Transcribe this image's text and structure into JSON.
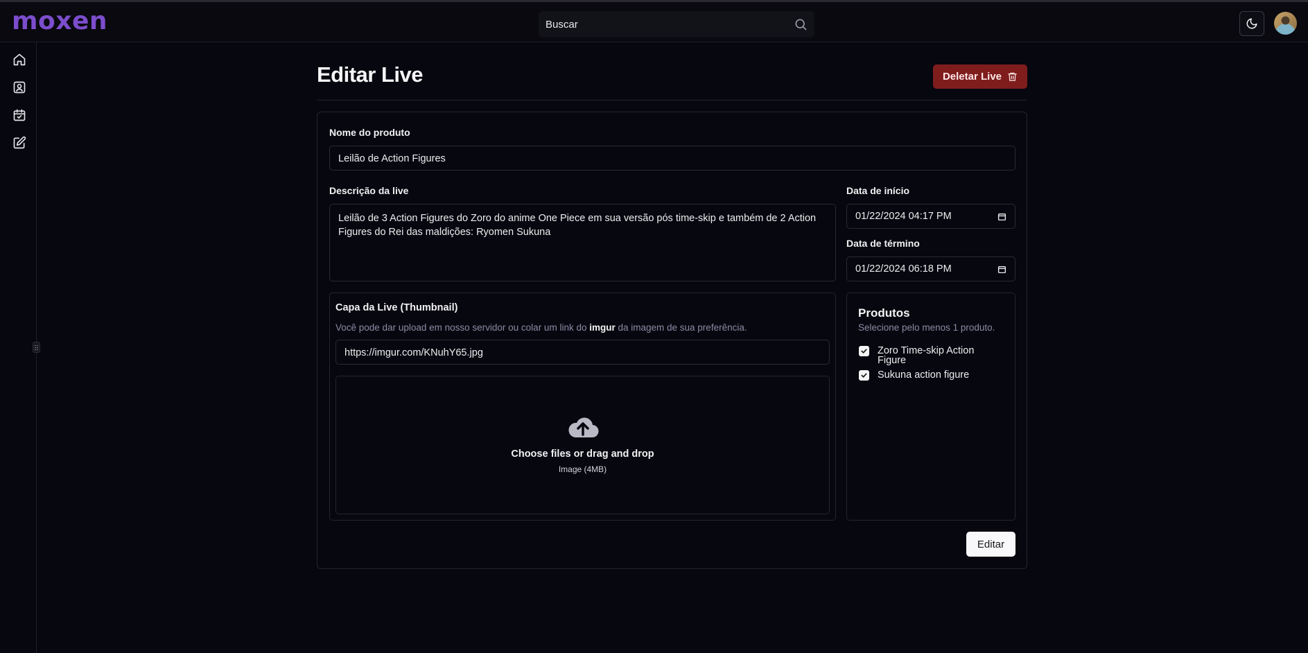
{
  "app": {
    "logo": "moxen"
  },
  "header": {
    "search_placeholder": "Buscar",
    "theme_icon": "moon-icon",
    "avatar_icon": "user-avatar"
  },
  "sidebar": {
    "items": [
      {
        "icon": "home-icon"
      },
      {
        "icon": "user-square-icon"
      },
      {
        "icon": "calendar-check-icon"
      },
      {
        "icon": "edit-square-icon"
      }
    ]
  },
  "page": {
    "title": "Editar Live",
    "delete_label": "Deletar Live"
  },
  "form": {
    "name_label": "Nome do produto",
    "name_value": "Leilão de Action Figures",
    "desc_label": "Descrição da live",
    "desc_value": "Leilão de 3 Action Figures do Zoro do anime One Piece em sua versão pós time-skip e também de 2 Action Figures do Rei das maldições: Ryomen Sukuna",
    "start_label": "Data de início",
    "start_value": "01/22/2024 04:17 PM",
    "end_label": "Data de término",
    "end_value": "01/22/2024 06:18 PM",
    "thumb_label": "Capa da Live (Thumbnail)",
    "thumb_help_1": "Você pode dar upload em nosso servidor ou colar um link do ",
    "thumb_help_link": "imgur",
    "thumb_help_2": " da imagem de sua preferência.",
    "thumb_url": "https://imgur.com/KNuhY65.jpg",
    "dropzone_title": "Choose files or drag and drop",
    "dropzone_sub": "Image (4MB)",
    "products_title": "Produtos",
    "products_help": "Selecione pelo menos 1 produto.",
    "products": [
      {
        "line1": "Zoro Time-skip Action",
        "line2": "Figure",
        "checked": true
      },
      {
        "line1": "Sukuna action figure",
        "line2": "",
        "checked": true
      }
    ],
    "submit_label": "Editar"
  }
}
